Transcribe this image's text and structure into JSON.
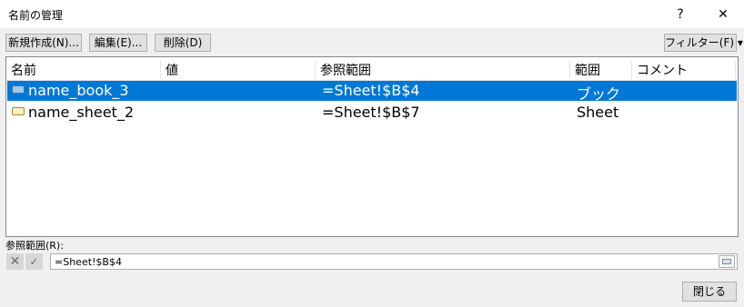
{
  "window": {
    "title": "名前の管理",
    "help_label": "?",
    "close_label": "✕"
  },
  "toolbar": {
    "new_label": "新規作成(N)...",
    "edit_label": "編集(E)...",
    "delete_label": "削除(D)",
    "filter_label": "フィルター(F) ▾"
  },
  "list": {
    "columns": [
      "名前",
      "値",
      "参照範囲",
      "範囲",
      "コメント"
    ],
    "rows": [
      {
        "icon": "workbook-name-icon",
        "name": "name_book_3",
        "value": "",
        "refers_to": "=Sheet!$B$4",
        "scope": "ブック",
        "comment": "",
        "selected": true
      },
      {
        "icon": "sheet-name-icon",
        "name": "name_sheet_2",
        "value": "",
        "refers_to": "=Sheet!$B$7",
        "scope": "Sheet",
        "comment": "",
        "selected": false
      }
    ]
  },
  "refers_to": {
    "label": "参照範囲(R):",
    "value": "=Sheet!$B$4",
    "cancel_glyph": "✕",
    "ok_glyph": "✓"
  },
  "footer": {
    "close_label": "閉じる"
  },
  "colors": {
    "selection": "#0078d7",
    "background": "#f0f0f0"
  }
}
